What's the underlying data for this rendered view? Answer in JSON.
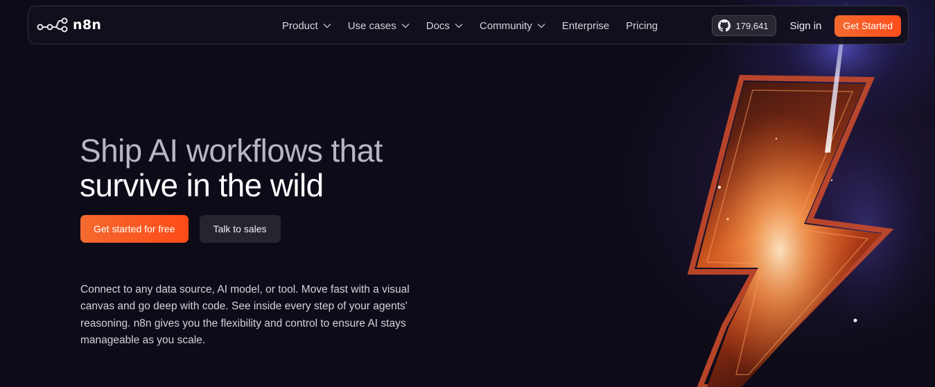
{
  "brand": {
    "name": "n8n",
    "logo_icon": "n8n-nodes-logo-icon"
  },
  "nav": {
    "items": [
      {
        "label": "Product",
        "has_dropdown": true
      },
      {
        "label": "Use cases",
        "has_dropdown": true
      },
      {
        "label": "Docs",
        "has_dropdown": true
      },
      {
        "label": "Community",
        "has_dropdown": true
      },
      {
        "label": "Enterprise",
        "has_dropdown": false
      },
      {
        "label": "Pricing",
        "has_dropdown": false
      }
    ],
    "github_stars": "179,641",
    "github_icon": "github-icon",
    "sign_in": "Sign in",
    "get_started": "Get Started"
  },
  "hero": {
    "title_line1": "Ship AI workflows that",
    "title_line2": "survive in the wild",
    "cta_primary": "Get started for free",
    "cta_secondary": "Talk to sales",
    "description": "Connect to any data source, AI model, or tool. Move fast with a visual canvas and go deep with code. See inside every step of your agents' reasoning. n8n gives you the flexibility and control to ensure AI stays manageable as you scale."
  },
  "colors": {
    "background": "#0e0b18",
    "accent_orange": "#ff5a1f",
    "nav_border": "#34303f",
    "secondary_button": "#27242f"
  }
}
